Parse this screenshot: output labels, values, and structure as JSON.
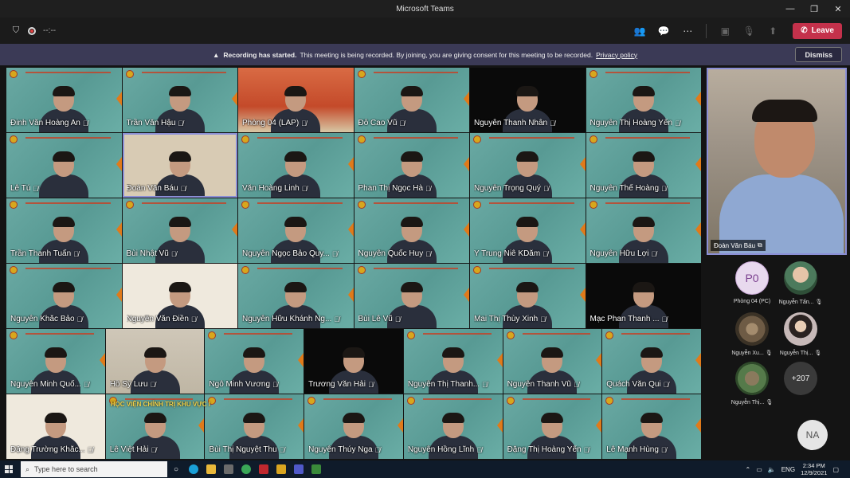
{
  "window": {
    "title": "Microsoft Teams",
    "controls": [
      "—",
      "❐",
      "✕"
    ]
  },
  "toolbar": {
    "timer": "--:--",
    "leave_label": "Leave",
    "icons": [
      "participants-icon",
      "chat-icon",
      "more-icon",
      "camera-off-icon",
      "mic-off-icon",
      "share-icon"
    ]
  },
  "banner": {
    "title": "Recording has started.",
    "message": "This meeting is being recorded. By joining, you are giving consent for this meeting to be recorded.",
    "link": "Privacy policy",
    "dismiss_label": "Dismiss"
  },
  "tiles": [
    {
      "name": "Đinh Văn Hoàng An",
      "style": "slide"
    },
    {
      "name": "Trần Văn Hậu",
      "style": "slide"
    },
    {
      "name": "Phòng 04 (LAP)",
      "style": "red"
    },
    {
      "name": "Đỗ Cao Vũ",
      "style": "slide"
    },
    {
      "name": "Nguyễn Thanh Nhân",
      "style": "dark"
    },
    {
      "name": "Nguyễn Thị Hoàng Yến",
      "style": "slide"
    },
    {
      "name": "Lê Tú",
      "style": "slide"
    },
    {
      "name": "Đoàn Văn Báu",
      "style": "room",
      "speaking": true
    },
    {
      "name": "Văn Hoàng Linh",
      "style": "slide"
    },
    {
      "name": "Phan Thị Ngọc Hà",
      "style": "slide"
    },
    {
      "name": "Nguyễn Trọng Quý",
      "style": "slide"
    },
    {
      "name": "Nguyễn Thế Hoàng",
      "style": "slide"
    },
    {
      "name": "Trần Thanh Tuấn",
      "style": "slide"
    },
    {
      "name": "Bùi Nhật Vũ",
      "style": "slide"
    },
    {
      "name": "Nguyễn Ngọc Bảo Quy...",
      "style": "slide"
    },
    {
      "name": "Nguyễn Quốc Huy",
      "style": "slide"
    },
    {
      "name": "Y Trung Niê KDăm",
      "style": "slide"
    },
    {
      "name": "Nguyễn Hữu Lợi",
      "style": "slide"
    },
    {
      "name": "Nguyễn Khắc Bảo",
      "style": "slide"
    },
    {
      "name": "Nguyễn Văn Điền",
      "style": "bright"
    },
    {
      "name": "Nguyễn Hữu Khánh Ng...",
      "style": "slide"
    },
    {
      "name": "Bùi Lê Vũ",
      "style": "slide"
    },
    {
      "name": "Mai Thị Thùy Xinh",
      "style": "slide"
    },
    {
      "name": "Mạc Phan Thanh ...",
      "style": "dark"
    },
    {
      "name": "Nguyễn Minh Quố...",
      "style": "slide"
    },
    {
      "name": "Hồ Sỹ Lưu",
      "style": "office"
    },
    {
      "name": "Ngô Minh Vương",
      "style": "slide"
    },
    {
      "name": "Trương Văn Hải",
      "style": "dark"
    },
    {
      "name": "Nguyễn Thị Thanh...",
      "style": "slide"
    },
    {
      "name": "Nguyễn Thanh Vũ",
      "style": "slide"
    },
    {
      "name": "Quách Văn Qui",
      "style": "slide"
    },
    {
      "name": "Đặng Trường Khắc...",
      "style": "bright"
    },
    {
      "name": "Lê Việt Hải",
      "style": "slide"
    },
    {
      "name": "Bùi Thị Nguyệt Thu",
      "style": "slide"
    },
    {
      "name": "Nguyễn Thúy Nga",
      "style": "slide"
    },
    {
      "name": "Nguyễn Hồng Lĩnh",
      "style": "slide"
    },
    {
      "name": "Đặng Thị Hoàng Yến",
      "style": "slide"
    },
    {
      "name": "Lê Mạnh Hùng",
      "style": "slide"
    }
  ],
  "banner_text_tile": "HỌC VIỆN CHÍNH TRỊ KHU VỰC I",
  "featured": {
    "name": "Đoàn Văn Báu"
  },
  "roster": [
    {
      "name": "Phòng 04 (PC)",
      "initials": "P0",
      "avatar": "init"
    },
    {
      "name": "Nguyễn Tấn...",
      "initials": "",
      "avatar": "photo1"
    },
    {
      "name": "Nguyễn Xu...",
      "initials": "",
      "avatar": "photo2"
    },
    {
      "name": "Nguyễn Thị...",
      "initials": "",
      "avatar": "photo3"
    },
    {
      "name": "Nguyễn Thị...",
      "initials": "",
      "avatar": "photo4"
    },
    {
      "name": "",
      "initials": "+207",
      "avatar": "more"
    }
  ],
  "self_initials": "NA",
  "taskbar": {
    "search_placeholder": "Type here to search",
    "lang": "ENG",
    "time": "2:34 PM",
    "date": "12/9/2021"
  }
}
